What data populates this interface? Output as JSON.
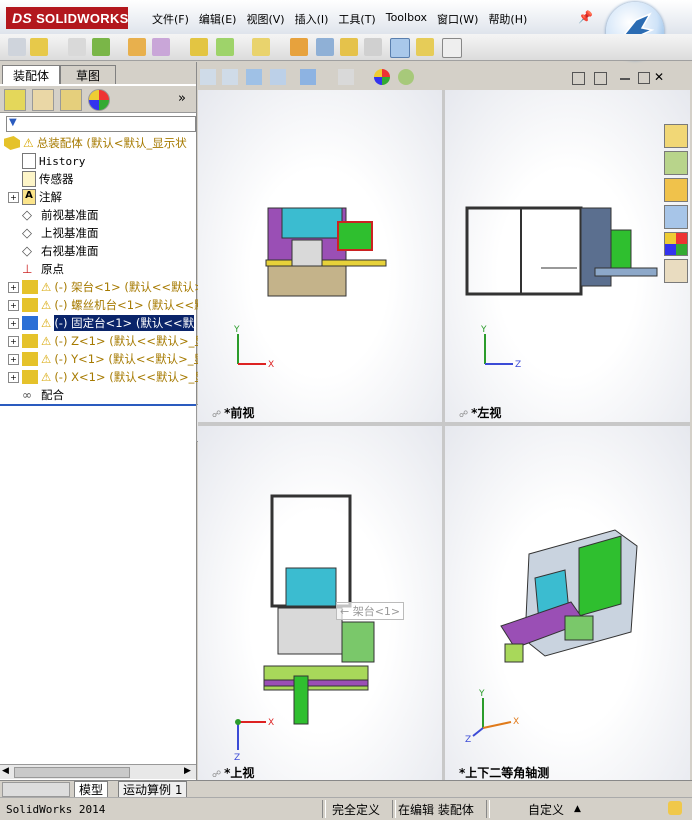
{
  "app": {
    "brand_ds": "DS",
    "brand": "SOLIDWORKS"
  },
  "menu": [
    "文件(F)",
    "编辑(E)",
    "视图(V)",
    "插入(I)",
    "工具(T)",
    "Toolbox",
    "窗口(W)",
    "帮助(H)"
  ],
  "panel_tabs": [
    "装配体",
    "草图"
  ],
  "panel_expand": "»",
  "tree": {
    "root": "总装配体  (默认<默认_显示状",
    "items": [
      {
        "label": "History",
        "type": "history"
      },
      {
        "label": "传感器",
        "type": "sensor"
      },
      {
        "label": "注解",
        "type": "annotation",
        "expand": "+"
      },
      {
        "label": "前视基准面",
        "type": "plane"
      },
      {
        "label": "上视基准面",
        "type": "plane"
      },
      {
        "label": "右视基准面",
        "type": "plane"
      },
      {
        "label": "原点",
        "type": "origin"
      },
      {
        "label": "(-) 架台<1> (默认<<默认>",
        "type": "part",
        "expand": "+"
      },
      {
        "label": "(-) 螺丝机台<1> (默认<<默",
        "type": "part",
        "expand": "+"
      },
      {
        "label": "(-) 固定台<1> (默认<<默",
        "type": "part-selected",
        "expand": "+"
      },
      {
        "label": "(-) Z<1> (默认<<默认>_显",
        "type": "part",
        "expand": "+"
      },
      {
        "label": "(-) Y<1> (默认<<默认>_显",
        "type": "part",
        "expand": "+"
      },
      {
        "label": "(-) X<1> (默认<<默认>_显",
        "type": "part",
        "expand": "+"
      },
      {
        "label": "配合",
        "type": "mates"
      }
    ]
  },
  "viewports": {
    "front": "*前视",
    "left": "*左视",
    "top": "*上视",
    "iso": "*上下二等角轴测"
  },
  "tooltip": "架台<1>",
  "axes": {
    "x": "X",
    "y": "Y",
    "z": "Z"
  },
  "bottom_tabs": [
    "模型",
    "运动算例 1"
  ],
  "status": {
    "app": "SolidWorks 2014",
    "state": "完全定义",
    "editing": "在编辑 装配体",
    "units": "自定义"
  },
  "colors": {
    "brand_red": "#b3171d",
    "selection": "#0a246a",
    "tree_yellow": "#a67a00"
  }
}
